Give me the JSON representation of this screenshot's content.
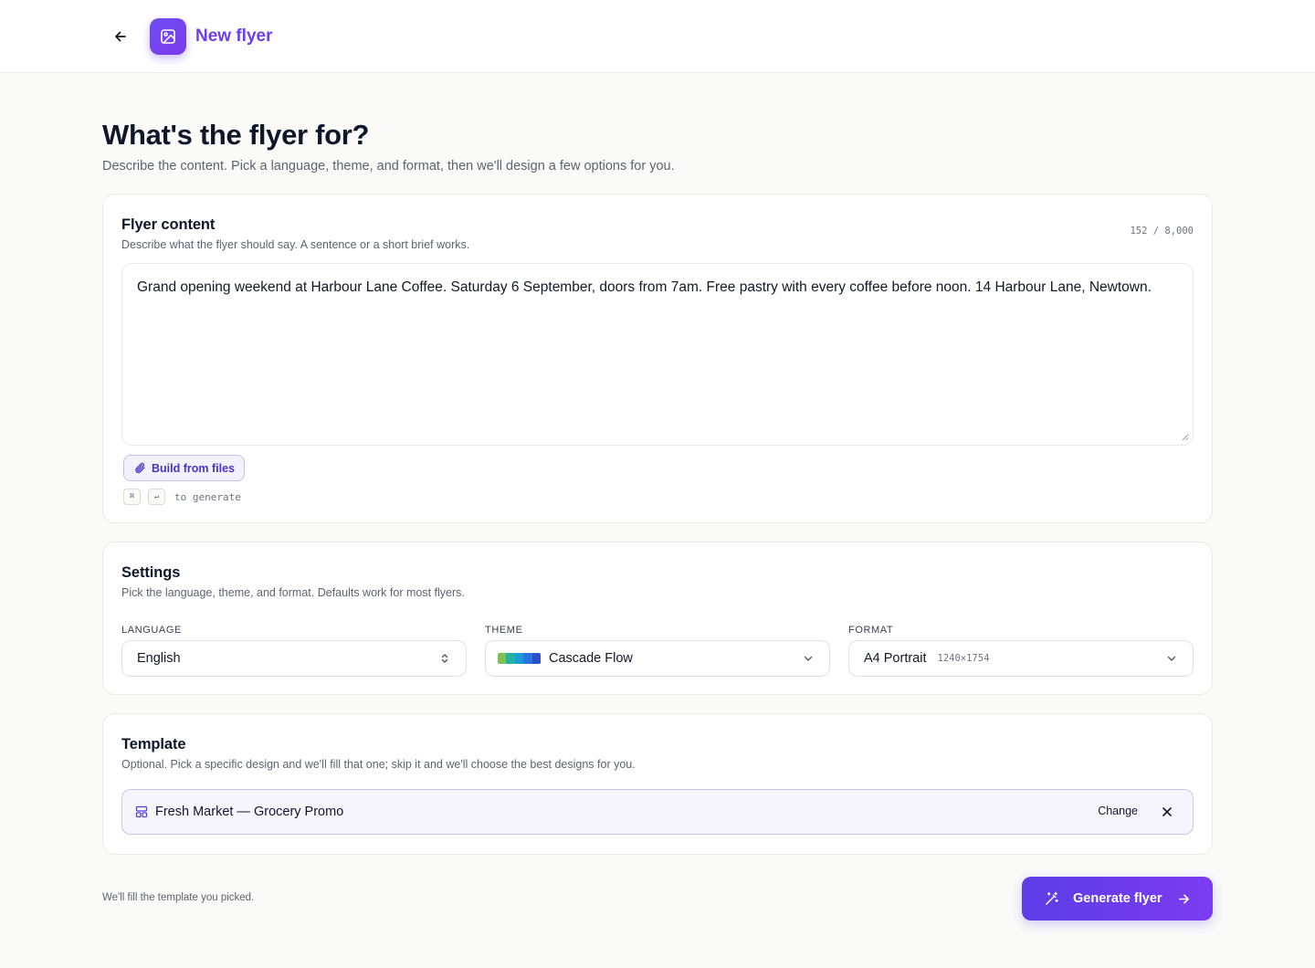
{
  "header": {
    "title": "New flyer",
    "back_icon": "arrow-left-icon",
    "app_icon": "image-icon",
    "accent_color": "#6d3df0"
  },
  "page": {
    "heading": "What's the flyer for?",
    "subtitle": "Describe the content. Pick a language, theme, and format, then we'll design a few options for you."
  },
  "content_card": {
    "title": "Flyer content",
    "description": "Describe what the flyer should say. A sentence or a short brief works.",
    "counter": "152 / 8,000",
    "text": "Grand opening weekend at Harbour Lane Coffee. Saturday 6 September, doors from 7am. Free pastry with every coffee before noon. 14 Harbour Lane, Newtown.",
    "files_button": "Build from files",
    "files_icon": "paperclip-icon",
    "shortcut_keys": [
      "⌘",
      "↵"
    ],
    "shortcut_hint": "to generate"
  },
  "settings_card": {
    "title": "Settings",
    "description": "Pick the language, theme, and format. Defaults work for most flyers.",
    "language": {
      "label": "LANGUAGE",
      "value": "English",
      "icon": "chevron-up-down-icon"
    },
    "theme": {
      "label": "THEME",
      "value": "Cascade Flow",
      "icon": "chevron-down-icon",
      "swatch_colors": [
        "#7bc251",
        "#23b3a4",
        "#1a9bd7",
        "#2b73e3",
        "#2b4fc9"
      ]
    },
    "format": {
      "label": "FORMAT",
      "value": "A4 Portrait",
      "dimensions": "1240×1754",
      "icon": "chevron-down-icon"
    }
  },
  "template_card": {
    "title": "Template",
    "description": "Optional. Pick a specific design and we'll fill that one; skip it and we'll choose the best designs for you.",
    "selected": "Fresh Market — Grocery Promo",
    "template_icon": "layout-icon",
    "change_label": "Change",
    "clear_icon": "close-icon"
  },
  "footer": {
    "note": "We'll fill the template you picked.",
    "generate_label": "Generate flyer",
    "generate_icon": "magic-wand-icon",
    "arrow_icon": "arrow-right-icon"
  }
}
